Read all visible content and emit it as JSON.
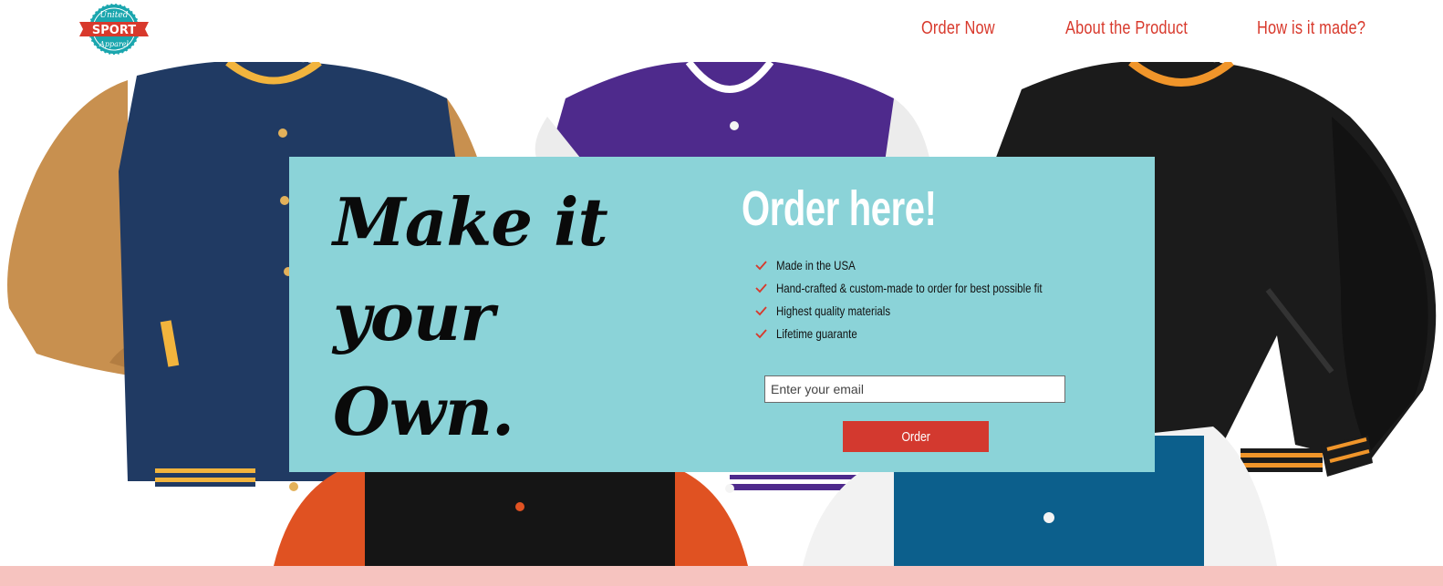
{
  "brand": {
    "logo_top": "United",
    "logo_main": "SPORT",
    "logo_bottom": "Apparel",
    "colors": {
      "teal": "#1aa6ae",
      "red": "#d8392c"
    }
  },
  "nav": {
    "items": [
      {
        "label": "Order Now"
      },
      {
        "label": "About the Product"
      },
      {
        "label": "How is it made?"
      }
    ]
  },
  "hero": {
    "headline": [
      "Make it",
      "your",
      "Own."
    ],
    "order_title": "Order here!",
    "features": [
      {
        "text": "Made in the USA",
        "icon": "check-icon"
      },
      {
        "text": "Hand-crafted & custom-made to order for best possible fit",
        "icon": "check-icon"
      },
      {
        "text": "Highest quality materials",
        "icon": "check-icon"
      },
      {
        "text": "Lifetime guarante",
        "icon": "check-icon"
      }
    ],
    "email_placeholder": "Enter your email",
    "email_value": "",
    "button_label": "Order",
    "panel_color": "#8bd3d8",
    "button_color": "#d3392f"
  },
  "footer": {
    "color": "#f6c3bf"
  }
}
